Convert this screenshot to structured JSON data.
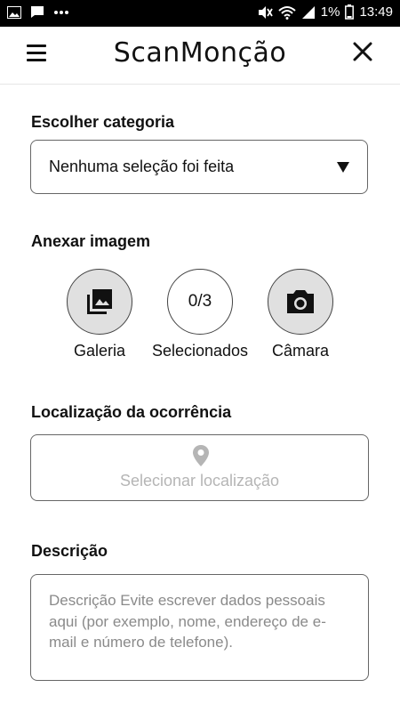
{
  "status_bar": {
    "battery": "1%",
    "time": "13:49",
    "icons": [
      "gallery-icon",
      "message-icon",
      "more-icon",
      "mute-icon",
      "wifi-icon",
      "signal-icon",
      "battery-icon"
    ]
  },
  "app_bar": {
    "title": "ScanMonção",
    "menu_icon": "menu-icon",
    "close_icon": "close-icon"
  },
  "category": {
    "label": "Escolher categoria",
    "selected": "Nenhuma seleção foi feita"
  },
  "attach": {
    "label": "Anexar imagem",
    "gallery_label": "Galeria",
    "selected_count": "0/3",
    "selected_label": "Selecionados",
    "camera_label": "Câmara"
  },
  "location": {
    "label": "Localização da ocorrência",
    "placeholder": "Selecionar localização"
  },
  "description": {
    "label": "Descrição",
    "placeholder": "Descrição Evite escrever dados pessoais aqui (por exemplo, nome, endereço de e-mail e número de telefone)."
  },
  "colors": {
    "status_bar_bg": "#000000",
    "circle_fill": "#e0e0e0",
    "placeholder": "#b5b5b5"
  }
}
